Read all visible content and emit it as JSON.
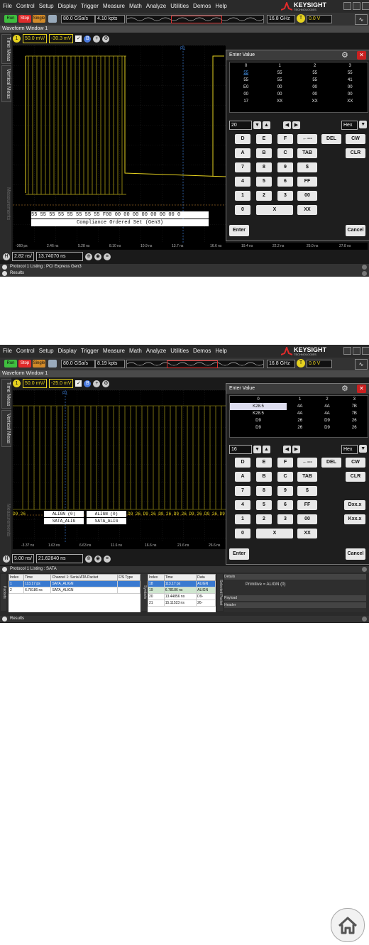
{
  "menus": [
    "File",
    "Control",
    "Setup",
    "Display",
    "Trigger",
    "Measure",
    "Math",
    "Analyze",
    "Utilities",
    "Demos",
    "Help"
  ],
  "brand": {
    "name": "KEYSIGHT",
    "sub": "TECHNOLOGIES"
  },
  "toolbar": {
    "run": "Run",
    "stop": "Stop",
    "single": "Single",
    "bandwidth": "16.8 GHz",
    "trig_level": "0.0 V"
  },
  "window_title": "Waveform Window 1",
  "side_tabs": {
    "time": "Time Meas",
    "vertical": "Vertical Meas",
    "measurements": "Measurements"
  },
  "colors": {
    "trace": "#e6d21f",
    "marker": "#3a7ad0",
    "close": "#c92020"
  },
  "shot1": {
    "sample_rate": "80.0 GSa/s",
    "points": "4.10 kpts",
    "ch_scale": "50.0 mV/",
    "ch_offset": "-30.3 mV",
    "marker": "P1",
    "decode_symbols": [
      "55",
      "55",
      "55",
      "55",
      "55",
      "55",
      "55",
      "55",
      "F",
      "0",
      "0",
      "0",
      "0",
      "0",
      "0",
      "0",
      "0",
      "0",
      "0",
      "0",
      "0",
      "0",
      "0",
      "0",
      "0",
      "0"
    ],
    "decode_label": "Compliance Ordered Set (Gen3)",
    "x_ticks": [
      "-360 ps",
      "2.46 ns",
      "5.28 ns",
      "8.10 ns",
      "10.9 ns",
      "13.7 ns",
      "16.6 ns",
      "19.4 ns",
      "22.2 ns",
      "25.0 ns",
      "27.8 ns"
    ],
    "h_scale": "2.82 ns/",
    "h_pos": "13.74070 ns",
    "protocol_bar": "Protocol 1 Listing : PCI Express Gen3",
    "results_bar": "Results",
    "dialog": {
      "title": "Enter Value",
      "cols": [
        "0",
        "1",
        "2",
        "3"
      ],
      "rows": [
        [
          "55",
          "55",
          "55",
          "55"
        ],
        [
          "55",
          "55",
          "55",
          "41"
        ],
        [
          "E0",
          "00",
          "00",
          "00"
        ],
        [
          "00",
          "00",
          "00",
          "00"
        ],
        [
          "17",
          "XX",
          "XX",
          "XX"
        ]
      ],
      "value": "20",
      "base": "Hex",
      "keys_row1": [
        "D",
        "E",
        "F"
      ],
      "keys_row2": [
        "A",
        "B",
        "C"
      ],
      "keys_row3": [
        "7",
        "8",
        "9"
      ],
      "keys_row4": [
        "4",
        "5",
        "6"
      ],
      "keys_row5": [
        "1",
        "2",
        "3"
      ],
      "keys_row6": [
        "0",
        "X"
      ],
      "side_keys": {
        "back": "←---",
        "del": "DEL",
        "cw": "CW",
        "tab": "TAB",
        "clr": "CLR",
        "dollar": "$",
        "ff": "FF",
        "zz": "00",
        "xx": "XX"
      },
      "enter": "Enter",
      "cancel": "Cancel"
    }
  },
  "shot2": {
    "sample_rate": "80.0 GSa/s",
    "points": "8.19 kpts",
    "ch_scale": "50.0 mV/",
    "ch_offset": "-25.0 mV",
    "marker": "P1",
    "decode_symbols_left": "ALIGN (0)",
    "decode_symbols_right": "ALIGN (0)",
    "decode_sub_left": "SATA_ALIG",
    "decode_sub_right": "SATA_ALIG",
    "decode_tail": "D9 26 D9 26 D9 26 D9 26 D9 26 D9 26 D9 26",
    "decode_head": "D9 26",
    "x_ticks": [
      "-3.37 ns",
      "1.63 ns",
      "6.63 ns",
      "11.6 ns",
      "16.6 ns",
      "21.6 ns",
      "26.6 ns"
    ],
    "h_scale": "5.00 ns/",
    "h_pos": "21.62840 ns",
    "protocol_bar": "Protocol 1 Listing : SATA",
    "results_bar": "Results",
    "packets": {
      "headers": [
        "Index",
        "Time",
        "Channel 1: Serial ATA Packet",
        "F/S Type"
      ],
      "rows": [
        [
          "1",
          "113.17 ps",
          "SATA_ALIGN",
          ""
        ],
        [
          "2",
          "6.78186 ns",
          "SATA_ALIGN",
          ""
        ]
      ]
    },
    "symbols": {
      "headers": [
        "Index",
        "Time",
        "Data"
      ],
      "rows": [
        [
          "18",
          "113.17 ps",
          "ALIGN"
        ],
        [
          "19",
          "6.78186 ns",
          "ALIGN"
        ],
        [
          "20",
          "13.44856 ns",
          "D9-"
        ],
        [
          "21",
          "15.11523 ns",
          "26-"
        ]
      ]
    },
    "details": {
      "title": "Details",
      "primitive": "Primitive = ALIGN (0)",
      "payload": "Payload",
      "header": "Header"
    },
    "vlabels": {
      "packets": "Packets",
      "symbols": "Symbols",
      "selected": "Selected Packet"
    },
    "dialog": {
      "title": "Enter Value",
      "cols": [
        "0",
        "1",
        "2",
        "3"
      ],
      "rows": [
        [
          "K28.5",
          "4A",
          "4A",
          "7B"
        ],
        [
          "K28.5",
          "4A",
          "4A",
          "7B"
        ],
        [
          "D9",
          "26",
          "D9",
          "26"
        ],
        [
          "D9",
          "26",
          "D9",
          "26"
        ]
      ],
      "value": "16",
      "base": "Hex",
      "keys_row1": [
        "D",
        "E",
        "F"
      ],
      "keys_row2": [
        "A",
        "B",
        "C"
      ],
      "keys_row3": [
        "7",
        "8",
        "9"
      ],
      "keys_row4": [
        "4",
        "5",
        "6"
      ],
      "keys_row5": [
        "1",
        "2",
        "3"
      ],
      "keys_row6": [
        "0",
        "X"
      ],
      "side_keys": {
        "back": "←---",
        "del": "DEL",
        "cw": "CW",
        "tab": "TAB",
        "clr": "CLR",
        "dollar": "$",
        "ff": "FF",
        "zz": "00",
        "xx": "XX",
        "dxx": "Dxx.x",
        "kxx": "Kxx.x"
      },
      "enter": "Enter",
      "cancel": "Cancel"
    }
  },
  "home_icon": "home-icon"
}
